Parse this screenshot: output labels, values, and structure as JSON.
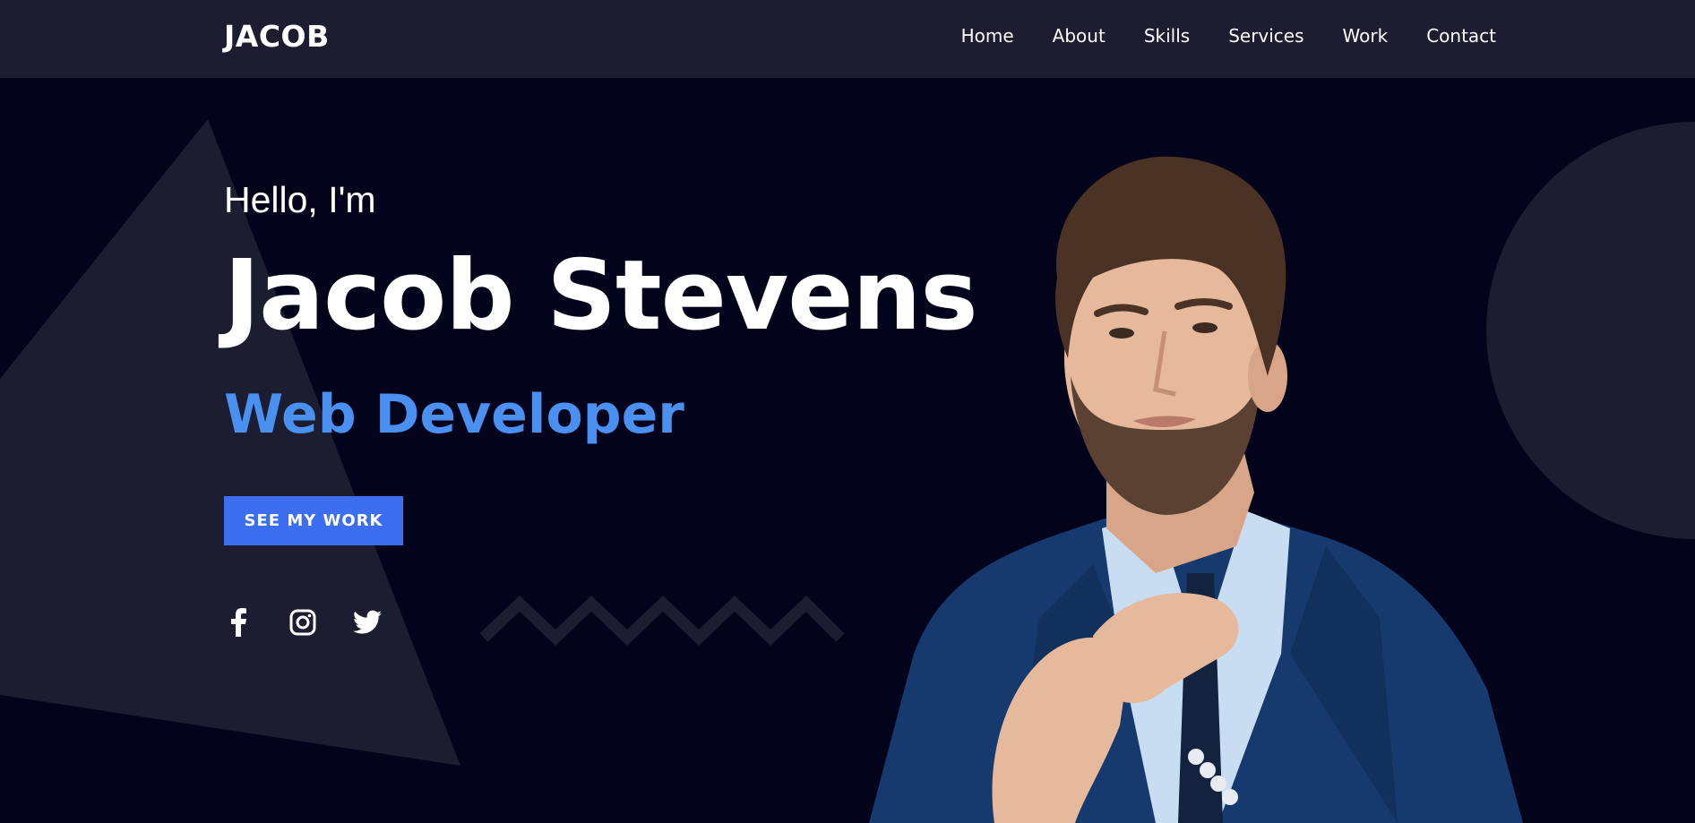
{
  "header": {
    "logo": "JACOB",
    "nav": [
      {
        "label": "Home"
      },
      {
        "label": "About"
      },
      {
        "label": "Skills"
      },
      {
        "label": "Services"
      },
      {
        "label": "Work"
      },
      {
        "label": "Contact"
      }
    ]
  },
  "hero": {
    "greeting": "Hello, I'm",
    "name": "Jacob Stevens",
    "role": "Web Developer",
    "cta_label": "SEE MY WORK"
  },
  "socials": [
    {
      "icon": "facebook-icon"
    },
    {
      "icon": "instagram-icon"
    },
    {
      "icon": "twitter-icon"
    }
  ],
  "colors": {
    "header_bg": "#1c1d30",
    "page_bg": "#03031c",
    "accent": "#4a90f0",
    "button": "#3b6ef1",
    "shape": "#1c1d30"
  }
}
